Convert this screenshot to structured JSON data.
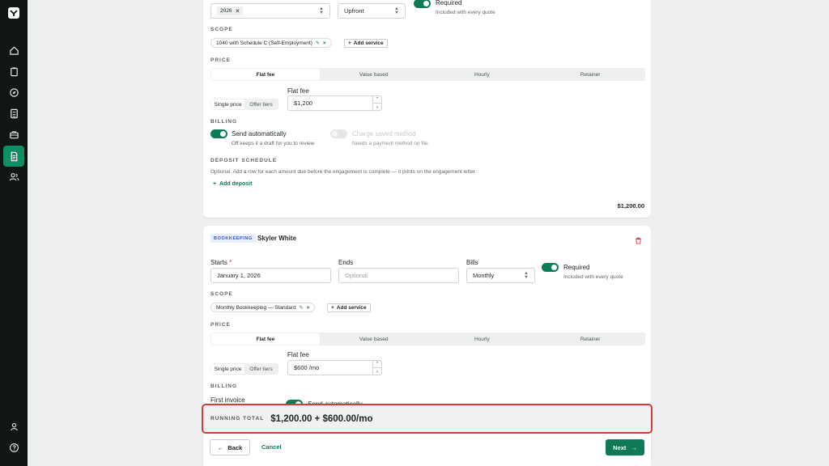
{
  "sidebar": {
    "logo": "app-logo",
    "items": [
      {
        "icon": "home-icon",
        "active": false
      },
      {
        "icon": "clipboard-icon",
        "active": false
      },
      {
        "icon": "compass-icon",
        "active": false
      },
      {
        "icon": "calculator-icon",
        "active": false
      },
      {
        "icon": "briefcase-icon",
        "active": false
      },
      {
        "icon": "document-icon",
        "active": true
      },
      {
        "icon": "users-icon",
        "active": false
      }
    ],
    "bottom": [
      {
        "icon": "user-icon"
      },
      {
        "icon": "help-icon"
      }
    ]
  },
  "card1": {
    "tax_year_value": "2026",
    "bills_value": "Upfront",
    "required_label": "Required",
    "required_note": "Included with every quote",
    "scope_heading": "SCOPE",
    "scope_chip": "1040 with Schedule C (Self-Employment)",
    "add_service": "Add service",
    "price_heading": "PRICE",
    "price_tabs": [
      "Flat fee",
      "Value based",
      "Hourly",
      "Retainer"
    ],
    "price_mode": [
      "Single price",
      "Offer tiers"
    ],
    "flat_fee_label": "Flat fee",
    "flat_fee_value": "$1,200",
    "billing_heading": "BILLING",
    "send_auto_label": "Send automatically",
    "send_auto_note": "Off keeps it a draft for you to review",
    "charge_label": "Charge saved method",
    "charge_note": "Needs a payment method on file",
    "deposit_heading": "DEPOSIT SCHEDULE",
    "deposit_note": "Optional. Add a row for each amount due before the engagement is complete — it prints on the engagement letter.",
    "add_deposit": "Add deposit",
    "total": "$1,200.00"
  },
  "card2": {
    "badge": "BOOKKEEPING",
    "client": "Skyler White",
    "starts_label": "Starts",
    "starts_required": "*",
    "starts_value": "January 1, 2026",
    "ends_label": "Ends",
    "ends_placeholder": "Optional",
    "bills_label": "Bills",
    "bills_value": "Monthly",
    "required_label": "Required",
    "required_note": "Included with every quote",
    "scope_heading": "SCOPE",
    "scope_chip": "Monthly Bookkeeping — Standard",
    "add_service": "Add service",
    "price_heading": "PRICE",
    "price_tabs": [
      "Flat fee",
      "Value based",
      "Hourly",
      "Retainer"
    ],
    "price_mode": [
      "Single price",
      "Offer tiers"
    ],
    "flat_fee_label": "Flat fee",
    "flat_fee_value": "$600 /mo",
    "billing_heading": "BILLING",
    "first_invoice_label": "First invoice",
    "send_auto_label": "Send automatically"
  },
  "running_total": {
    "label": "RUNNING TOTAL",
    "value": "$1,200.00 + $600.00/mo"
  },
  "footer": {
    "back": "Back",
    "cancel": "Cancel",
    "next": "Next"
  },
  "colors": {
    "accent": "#0f7a56",
    "sidebar": "#111513",
    "highlight_border": "#d63b3b",
    "badge_text": "#2f55d4"
  }
}
